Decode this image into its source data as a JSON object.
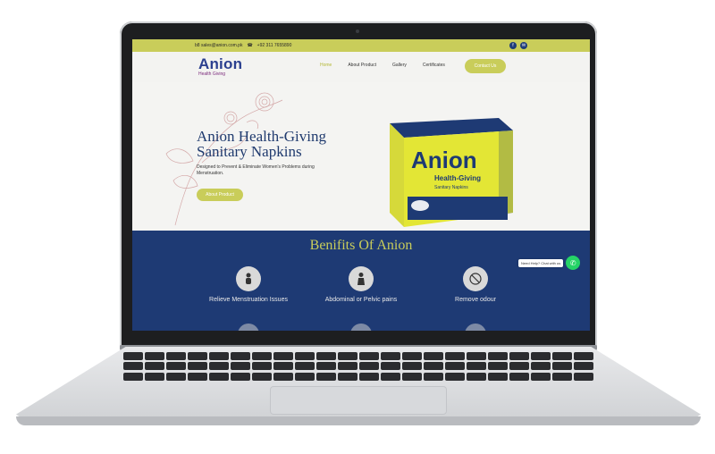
{
  "topbar": {
    "email": "b8 sales@anion.com.pk",
    "phone": "+92 311 7655890"
  },
  "logo": {
    "name": "Anion",
    "tagline": "Health Giving"
  },
  "nav": {
    "items": [
      "Home",
      "About Product",
      "Gallery",
      "Certificates"
    ],
    "contact": "Contact Us"
  },
  "hero": {
    "title": "Anion Health-Giving Sanitary Napkins",
    "description": "Designed to Prevent & Eliminate Women's Problems during Menstruation.",
    "button": "About Product"
  },
  "product": {
    "brand": "Anion",
    "line": "Health-Giving",
    "sub": "Sanitary Napkins"
  },
  "benefits": {
    "title": "Benifits Of Anion",
    "items": [
      "Relieve Menstruation Issues",
      "Abdominal or Pelvic pains",
      "Remove odour"
    ]
  },
  "whatsapp": {
    "label": "Need Help? Chat with us"
  },
  "colors": {
    "accent": "#c9cd5a",
    "navy": "#1e3a74",
    "brand": "#2b3f8f"
  }
}
